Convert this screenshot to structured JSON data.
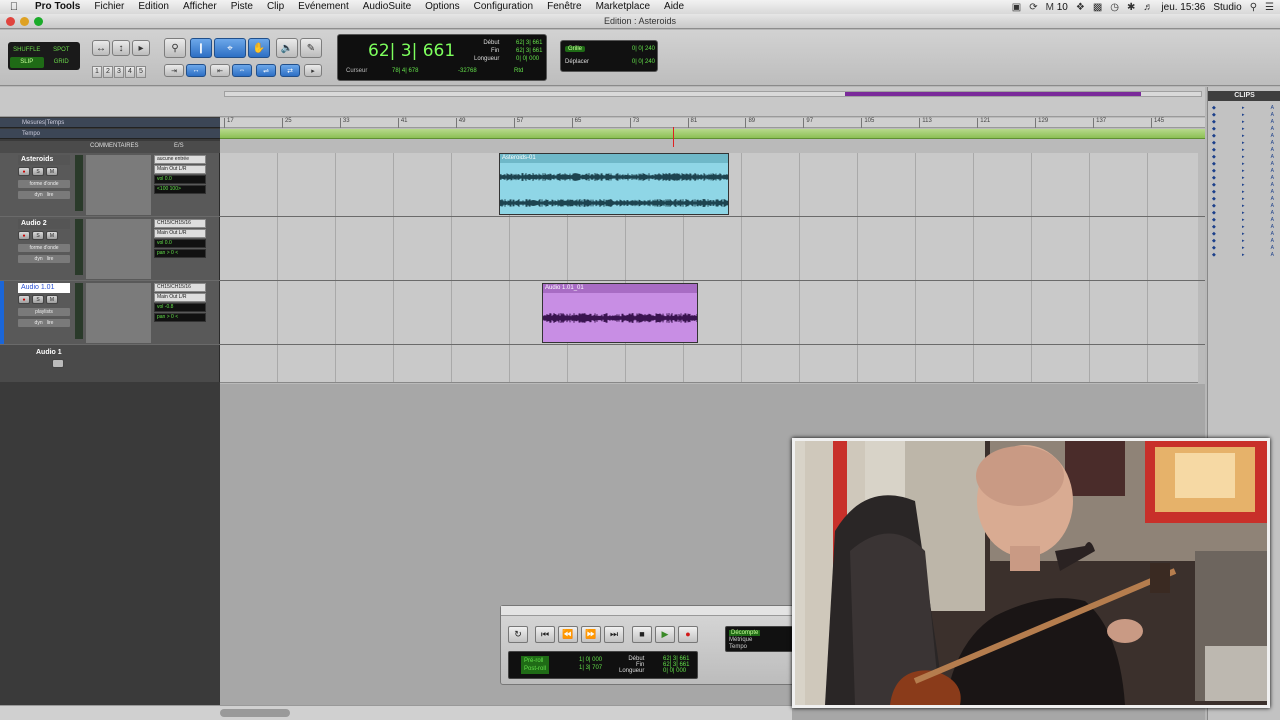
{
  "menubar": {
    "app": "Pro Tools",
    "items": [
      "Fichier",
      "Edition",
      "Afficher",
      "Piste",
      "Clip",
      "Evénement",
      "AudioSuite",
      "Options",
      "Configuration",
      "Fenêtre",
      "Marketplace",
      "Aide"
    ],
    "status_num": "10",
    "clock": "jeu. 15:36",
    "user": "Studio"
  },
  "window": {
    "title": "Edition : Asteroids"
  },
  "modes": {
    "shuffle": "SHUFFLE",
    "spot": "SPOT",
    "slip": "SLIP",
    "grid": "GRID"
  },
  "zoom_presets": [
    "1",
    "2",
    "3",
    "4",
    "5"
  ],
  "counter": {
    "main": "62| 3| 661",
    "cursor_label": "Curseur",
    "cursor_value": "78| 4| 678",
    "nudge_value": "-32768",
    "labels": [
      "Début",
      "Fin",
      "Longueur"
    ],
    "values": [
      "62| 3| 661",
      "62| 3| 661",
      "0| 0| 000"
    ],
    "rtd": "Rtd"
  },
  "grid": {
    "grille_label": "Grille",
    "grille_value": "0| 0| 240",
    "deplacer_label": "Déplacer",
    "deplacer_value": "0| 0| 240"
  },
  "rulers": {
    "bars": "Mesures|Temps",
    "tempo": "Tempo"
  },
  "bar_numbers": [
    "17",
    "25",
    "33",
    "41",
    "49",
    "57",
    "65",
    "73",
    "81",
    "89",
    "97",
    "105",
    "113",
    "121",
    "129",
    "137",
    "145"
  ],
  "columns": {
    "comments": "COMMENTAIRES",
    "io": "E/S"
  },
  "tracks": [
    {
      "name": "Asteroids",
      "view": "forme d'onde",
      "auto": "lire",
      "dyn": "dyn",
      "io": [
        "aucune entrée",
        "Main Out L/R"
      ],
      "vol": "vol 0.0",
      "pan": "<100 100>",
      "clip_name": "Asteroids-01",
      "clip_color": "#8fd6e6"
    },
    {
      "name": "Audio 2",
      "view": "forme d'onde",
      "auto": "lire",
      "dyn": "dyn",
      "io": [
        "CH15/CH15/16",
        "Main Out L/R"
      ],
      "vol": "vol 0.0",
      "pan": "pan > 0 <"
    },
    {
      "name": "Audio 1.01",
      "view": "playlists",
      "auto": "lire",
      "dyn": "dyn",
      "io": [
        "CH15/CH15/16",
        "Main Out L/R"
      ],
      "vol": "vol -0.8",
      "pan": "pan > 0 <",
      "clip_name": "Audio 1.01_01",
      "clip_color": "#c88ee4"
    }
  ],
  "empty_track": {
    "name": "Audio 1"
  },
  "clips_panel": {
    "title": "CLIPS"
  },
  "transport": {
    "preroll": "Pré-roll",
    "postroll": "Post-roll",
    "pre_value": "1| 0| 000",
    "post_value": "1| 3| 707",
    "labels": [
      "Début",
      "Fin",
      "Longueur"
    ],
    "values": [
      "62| 3| 661",
      "62| 3| 661",
      "0| 0| 000"
    ],
    "countoff": "Décompte",
    "metric": "Métrique",
    "tempo": "Tempo"
  },
  "colors": {
    "accent_blue": "#2d6fc4",
    "counter_green": "#63e04a",
    "tempo_green": "#8cc055"
  }
}
